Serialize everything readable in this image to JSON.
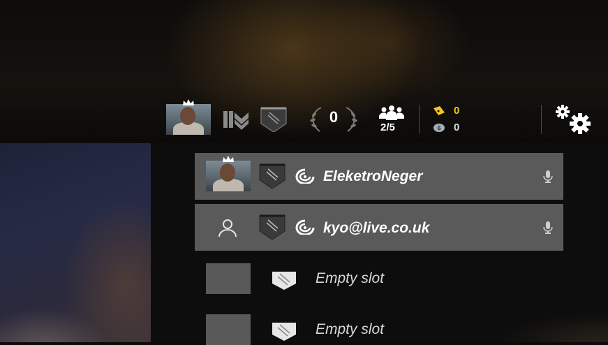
{
  "header": {
    "renown": "0",
    "squad_count": "2/5",
    "currency_yellow": "0",
    "currency_gray": "0"
  },
  "players": [
    {
      "name": "EleketroNeger",
      "has_photo": true
    },
    {
      "name": "kyo@live.co.uk",
      "has_photo": false
    }
  ],
  "empty_slots": [
    {
      "label": "Empty slot"
    },
    {
      "label": "Empty slot"
    }
  ],
  "colors": {
    "row_bg": "#5a5a5a",
    "accent_yellow": "#f2c81c",
    "gray_coin": "#a8b0b6"
  },
  "icons": [
    "crown-icon",
    "rank-chevron-icon",
    "shield-icon",
    "laurel-icon",
    "squad-icon",
    "ticket-icon",
    "coin-icon",
    "gear-icon",
    "uplay-icon",
    "microphone-icon",
    "user-icon"
  ]
}
